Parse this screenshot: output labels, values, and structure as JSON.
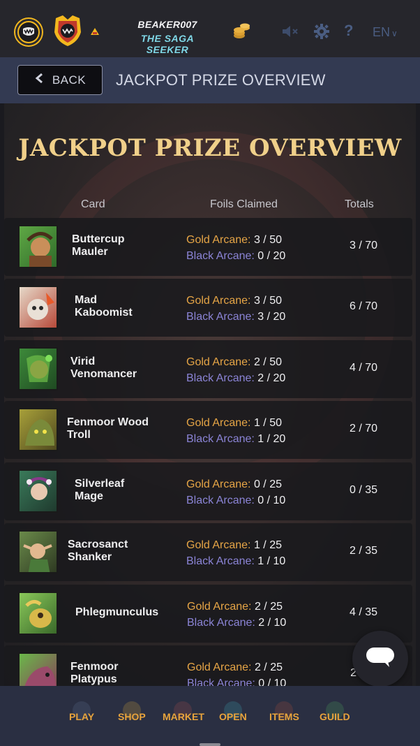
{
  "header": {
    "username": "BEAKER007",
    "user_title": "THE SAGA SEEKER",
    "language": "EN"
  },
  "subheader": {
    "back_label": "BACK",
    "title": "JACKPOT PRIZE OVERVIEW"
  },
  "page": {
    "title": "JACKPOT PRIZE OVERVIEW",
    "columns": {
      "card": "Card",
      "foils": "Foils Claimed",
      "totals": "Totals"
    }
  },
  "rows": [
    {
      "name_line1": "Buttercup",
      "name_line2": "Mauler",
      "gold_label": "Gold Arcane:",
      "gold_value": "3 / 50",
      "black_label": "Black Arcane:",
      "black_value": "0 / 20",
      "total": "3 / 70"
    },
    {
      "name_line1": "Mad",
      "name_line2": "Kaboomist",
      "gold_label": "Gold Arcane:",
      "gold_value": "3 / 50",
      "black_label": "Black Arcane:",
      "black_value": "3 / 20",
      "total": "6 / 70"
    },
    {
      "name_line1": "Virid",
      "name_line2": "Venomancer",
      "gold_label": "Gold Arcane:",
      "gold_value": "2 / 50",
      "black_label": "Black Arcane:",
      "black_value": "2 / 20",
      "total": "4 / 70"
    },
    {
      "name_line1": "Fenmoor Wood",
      "name_line2": "Troll",
      "gold_label": "Gold Arcane:",
      "gold_value": "1 / 50",
      "black_label": "Black Arcane:",
      "black_value": "1 / 20",
      "total": "2 / 70"
    },
    {
      "name_line1": "Silverleaf",
      "name_line2": "Mage",
      "gold_label": "Gold Arcane:",
      "gold_value": "0 / 25",
      "black_label": "Black Arcane:",
      "black_value": "0 / 10",
      "total": "0 / 35"
    },
    {
      "name_line1": "Sacrosanct",
      "name_line2": "Shanker",
      "gold_label": "Gold Arcane:",
      "gold_value": "1 / 25",
      "black_label": "Black Arcane:",
      "black_value": "1 / 10",
      "total": "2 / 35"
    },
    {
      "name_line1": "Phlegmunculus",
      "name_line2": "",
      "gold_label": "Gold Arcane:",
      "gold_value": "2 / 25",
      "black_label": "Black Arcane:",
      "black_value": "2 / 10",
      "total": "4 / 35"
    },
    {
      "name_line1": "Fenmoor",
      "name_line2": "Platypus",
      "gold_label": "Gold Arcane:",
      "gold_value": "2 / 25",
      "black_label": "Black Arcane:",
      "black_value": "0 / 10",
      "total": "2 /"
    }
  ],
  "nav": {
    "items": [
      {
        "label": "PLAY"
      },
      {
        "label": "SHOP"
      },
      {
        "label": "MARKET"
      },
      {
        "label": "OPEN"
      },
      {
        "label": "ITEMS"
      },
      {
        "label": "GUILD"
      }
    ]
  },
  "colors": {
    "gold_accent": "#e6a546",
    "black_arcane": "#8b84d6",
    "title_gold": "#f0d08a",
    "nav_orange": "#e8a43c",
    "user_title_cyan": "#7fd7e6"
  },
  "icons": {
    "avatar": "monster-face-badge",
    "rank": "shield-rank-badge",
    "small_rank": "small-rank-icon",
    "coins": "coin-stack-icon",
    "mute": "speaker-muted-icon",
    "settings": "gear-icon",
    "help": "question-icon",
    "lang_chevron": "chevron-down-icon",
    "back": "chevron-left-icon",
    "chat": "chat-bubble-icon"
  }
}
